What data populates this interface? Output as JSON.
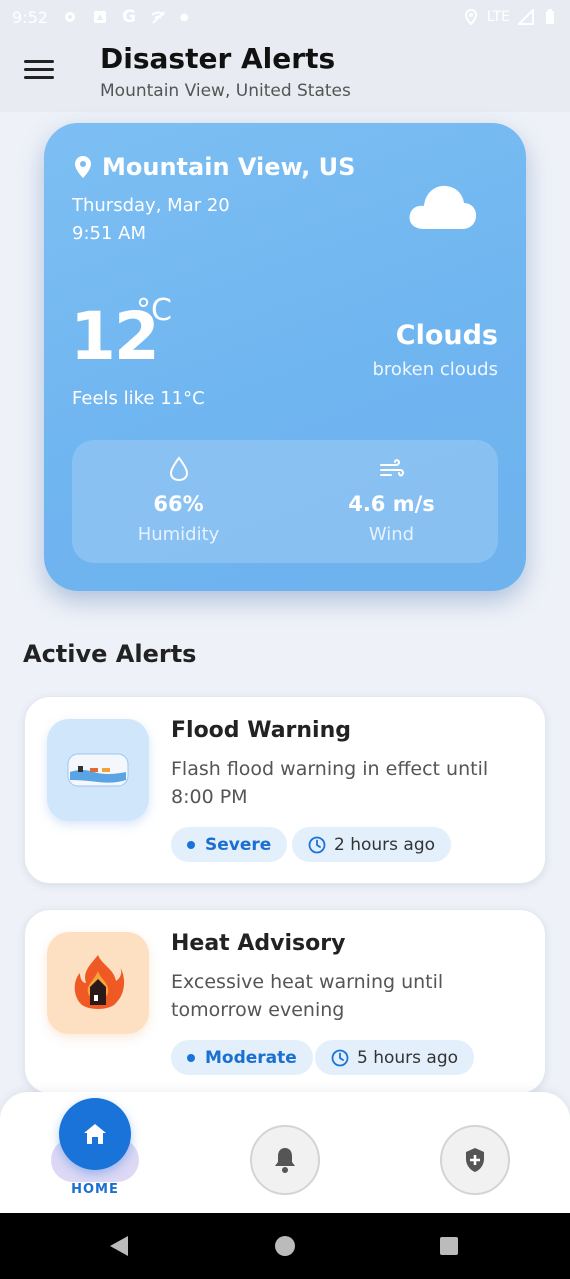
{
  "status_bar": {
    "time": "9:52",
    "network": "LTE"
  },
  "app_bar": {
    "title": "Disaster Alerts",
    "subtitle": "Mountain View, United States"
  },
  "weather": {
    "location": "Mountain View, US",
    "date": "Thursday, Mar 20",
    "time": "9:51 AM",
    "temperature": "12",
    "unit": "°C",
    "feels_like": "Feels like 11°C",
    "condition": "Clouds",
    "description": "broken clouds",
    "humidity_value": "66%",
    "humidity_label": "Humidity",
    "wind_value": "4.6 m/s",
    "wind_label": "Wind"
  },
  "alerts": {
    "section_title": "Active Alerts",
    "items": [
      {
        "title": "Flood Warning",
        "description": "Flash flood warning in effect until 8:00 PM",
        "severity": "Severe",
        "time": "2 hours ago"
      },
      {
        "title": "Heat Advisory",
        "description": "Excessive heat warning until tomorrow evening",
        "severity": "Moderate",
        "time": "5 hours ago"
      }
    ]
  },
  "bottom_nav": {
    "home_label": "HOME"
  },
  "colors": {
    "accent": "#1a73d9",
    "card_gradient_start": "#7dbff3",
    "card_gradient_end": "#6eb2ee"
  }
}
